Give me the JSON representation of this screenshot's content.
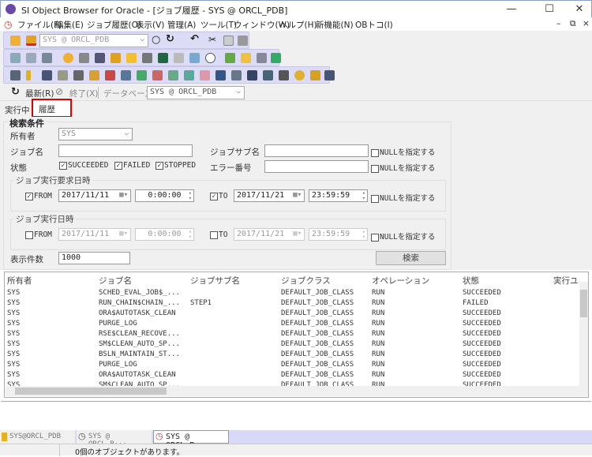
{
  "window": {
    "title": "SI Object Browser for Oracle - [ジョブ履歴 - SYS @ ORCL_PDB]",
    "minimize": "—",
    "maximize": "☐",
    "close": "✕"
  },
  "menu": {
    "items": [
      "ファイル(F)",
      "編集(E)",
      "ジョブ履歴(O)",
      "表示(V)",
      "管理(A)",
      "ツール(T)",
      "ウィンドウ(W)",
      "ヘルプ(H)",
      "新機能(N)",
      "OBトコ(I)"
    ],
    "mdi_min": "–",
    "mdi_restore": "⧉",
    "mdi_close": "×"
  },
  "toolbar": {
    "connection": "SYS @ ORCL_PDB"
  },
  "jobbar": {
    "refresh": "最新(R)",
    "stop": "終了(X)",
    "database_label": "データベース",
    "database": "SYS @ ORCL_PDB"
  },
  "tabs": [
    {
      "label": "実行中"
    },
    {
      "label": "履歴",
      "active": true
    }
  ],
  "form": {
    "group_title": "検索条件",
    "owner_label": "所有者",
    "owner": "SYS",
    "job_name_label": "ジョブ名",
    "job_name": "",
    "job_sub_label": "ジョブサブ名",
    "job_sub": "",
    "null_label": "NULLを指定する",
    "state_label": "状態",
    "states": [
      {
        "label": "SUCCEEDED",
        "checked": true
      },
      {
        "label": "FAILED",
        "checked": true
      },
      {
        "label": "STOPPED",
        "checked": true
      }
    ],
    "error_label": "エラー番号",
    "error": "",
    "req_group": "ジョブ実行要求日時",
    "req": {
      "from_label": "FROM",
      "from_checked": true,
      "from_date": "2017/11/11",
      "from_time": "0:00:00",
      "to_label": "TO",
      "to_checked": true,
      "to_date": "2017/11/21",
      "to_time": "23:59:59"
    },
    "run_group": "ジョブ実行日時",
    "run": {
      "from_label": "FROM",
      "from_checked": false,
      "from_date": "2017/11/11",
      "from_time": "0:00:00",
      "to_label": "TO",
      "to_checked": false,
      "to_date": "2017/11/21",
      "to_time": "23:59:59"
    },
    "count_label": "表示件数",
    "count": "1000",
    "search": "検索"
  },
  "grid": {
    "columns": [
      "所有者",
      "ジョブ名",
      "ジョブサブ名",
      "ジョブクラス",
      "オペレーション",
      "状態",
      "実行ユ"
    ],
    "rows": [
      [
        "SYS",
        "SCHED_EVAL_JOB$_...",
        "",
        "DEFAULT_JOB_CLASS",
        "RUN",
        "SUCCEEDED"
      ],
      [
        "SYS",
        "RUN_CHAIN$CHAIN_...",
        "STEP1",
        "DEFAULT_JOB_CLASS",
        "RUN",
        "FAILED"
      ],
      [
        "SYS",
        "ORA$AUTOTASK_CLEAN",
        "",
        "DEFAULT_JOB_CLASS",
        "RUN",
        "SUCCEEDED"
      ],
      [
        "SYS",
        "PURGE_LOG",
        "",
        "DEFAULT_JOB_CLASS",
        "RUN",
        "SUCCEEDED"
      ],
      [
        "SYS",
        "RSE$CLEAN_RECOVE...",
        "",
        "DEFAULT_JOB_CLASS",
        "RUN",
        "SUCCEEDED"
      ],
      [
        "SYS",
        "SM$CLEAN_AUTO_SP...",
        "",
        "DEFAULT_JOB_CLASS",
        "RUN",
        "SUCCEEDED"
      ],
      [
        "SYS",
        "BSLN_MAINTAIN_ST...",
        "",
        "DEFAULT_JOB_CLASS",
        "RUN",
        "SUCCEEDED"
      ],
      [
        "SYS",
        "PURGE_LOG",
        "",
        "DEFAULT_JOB_CLASS",
        "RUN",
        "SUCCEEDED"
      ],
      [
        "SYS",
        "ORA$AUTOTASK_CLEAN",
        "",
        "DEFAULT_JOB_CLASS",
        "RUN",
        "SUCCEEDED"
      ],
      [
        "SYS",
        "SM$CLEAN_AUTO_SP...",
        "",
        "DEFAULT_JOB_CLASS",
        "RUN",
        "SUCCEEDED"
      ]
    ]
  },
  "doc_tabs": [
    "SYS@ORCL_PDB",
    "SYS @ ORCL_P···",
    "SYS @ ORCL_P···"
  ],
  "status": {
    "message": "0個のオブジェクトがあります。"
  },
  "colors": {
    "toolbar": "#dcdcf6",
    "highlight": "#e00000",
    "doc_tab_bar": "#d8d8f8"
  }
}
